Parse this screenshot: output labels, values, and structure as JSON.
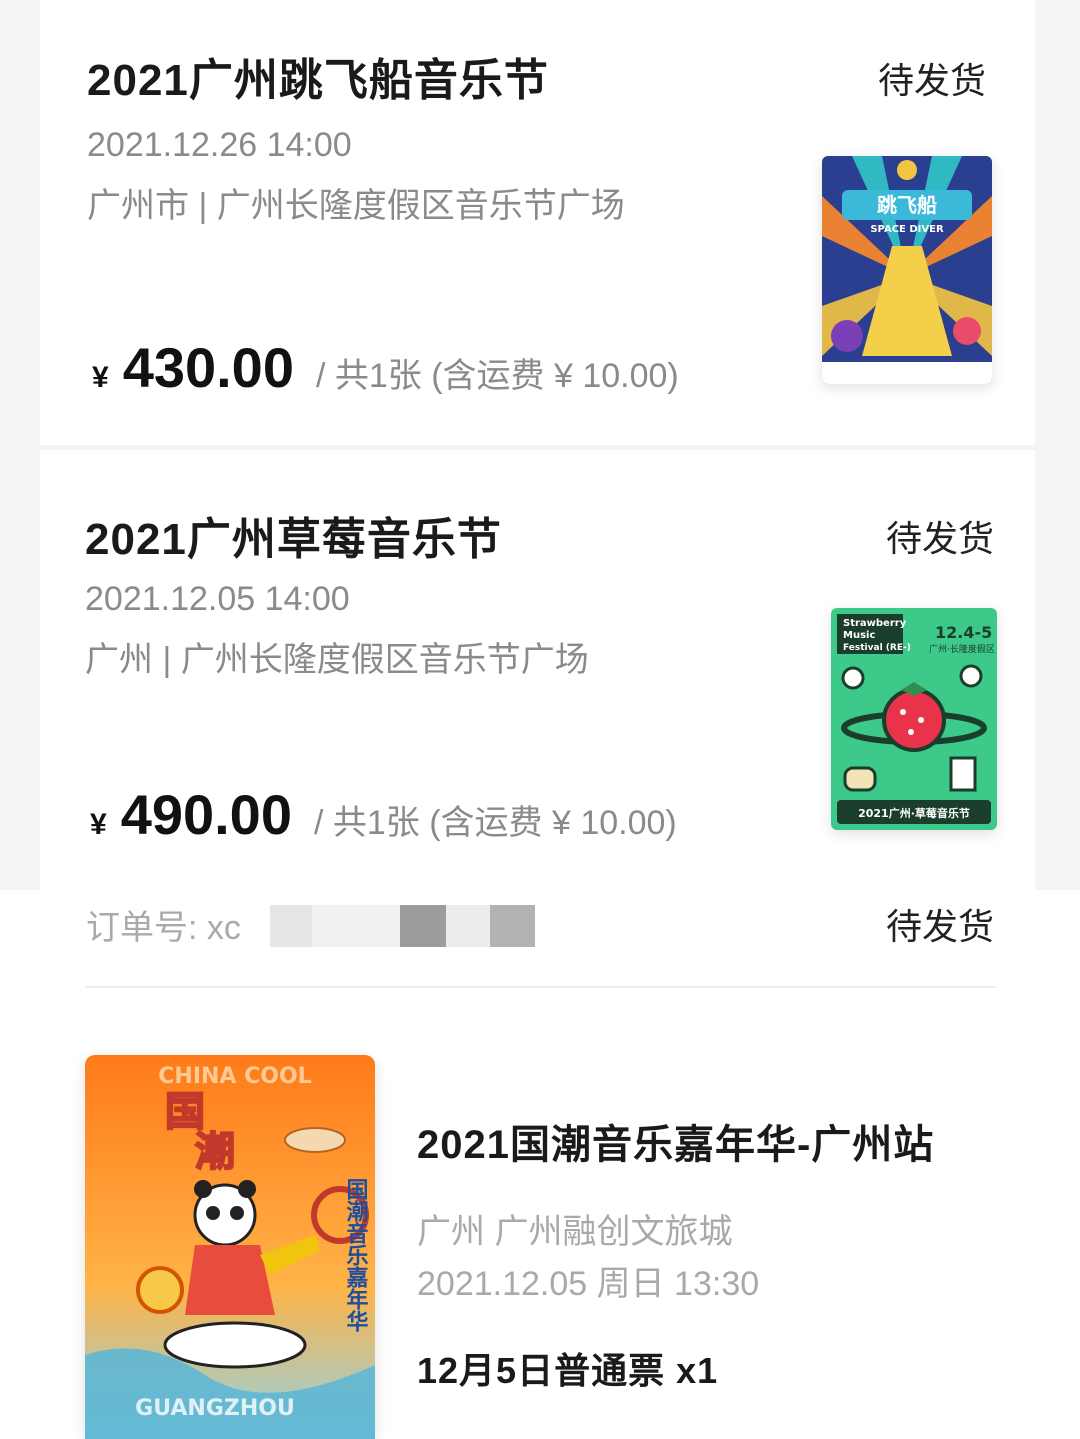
{
  "orders": [
    {
      "title": "2021广州跳飞船音乐节",
      "status": "待发货",
      "datetime": "2021.12.26 14:00",
      "venue": "广州市 | 广州长隆度假区音乐节广场",
      "currency": "¥",
      "amount": "430.00",
      "note": "/ 共1张 (含运费 ¥ 10.00)",
      "poster": {
        "heading": "跳飞船",
        "sub": "SPACE DIVER"
      }
    },
    {
      "title": "2021广州草莓音乐节",
      "status": "待发货",
      "datetime": "2021.12.05 14:00",
      "venue": "广州 | 广州长隆度假区音乐节广场",
      "currency": "¥",
      "amount": "490.00",
      "note": "/ 共1张 (含运费 ¥ 10.00)",
      "poster": {
        "line1": "Strawberry",
        "line2": "Music",
        "line3": "Festival (RE-)",
        "dates": "12.4-5",
        "place": "广州·长隆度假区",
        "footer": "2021广州·草莓音乐节"
      }
    }
  ],
  "third_order": {
    "order_no_label": "订单号: xc",
    "status": "待发货",
    "title": "2021国潮音乐嘉年华-广州站",
    "venue": "广州 广州融创文旅城",
    "datetime": "2021.12.05 周日 13:30",
    "ticket": "12月5日普通票 x1",
    "poster": {
      "heading_top": "国",
      "heading_bottom": "潮",
      "top_text": "CHINA COOL",
      "side": "国潮音乐嘉年华",
      "bottom": "GUANGZHOU"
    }
  },
  "colors": {
    "title": "#1a1a1a",
    "meta": "#8a8a8a",
    "card": "#ffffff"
  }
}
